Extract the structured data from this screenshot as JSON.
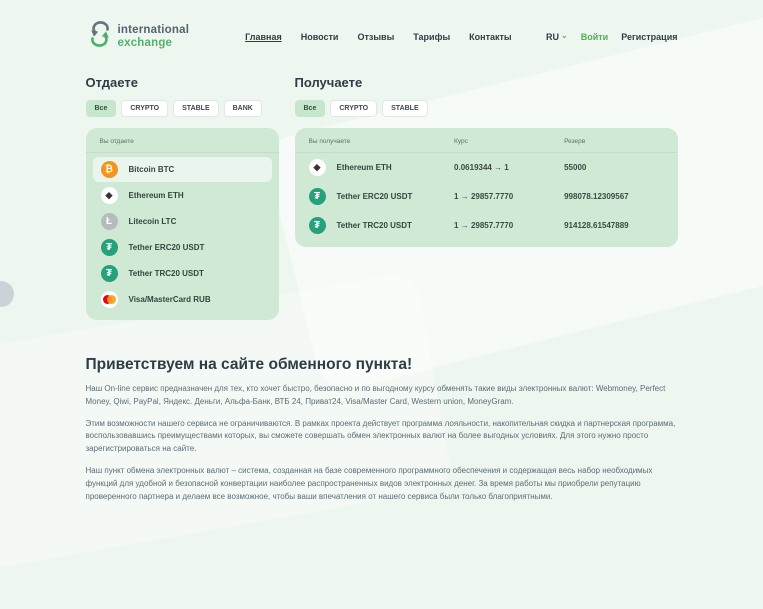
{
  "header": {
    "logo": {
      "line1": "international",
      "line2": "exchange"
    },
    "nav": [
      {
        "label": "Главная",
        "active": true
      },
      {
        "label": "Новости",
        "active": false
      },
      {
        "label": "Отзывы",
        "active": false
      },
      {
        "label": "Тарифы",
        "active": false
      },
      {
        "label": "Контакты",
        "active": false
      }
    ],
    "lang": "RU",
    "login_label": "Войти",
    "register_label": "Регистрация"
  },
  "give": {
    "title": "Отдаете",
    "tabs": [
      {
        "label": "Все",
        "active": true
      },
      {
        "label": "CRYPTO",
        "active": false
      },
      {
        "label": "STABLE",
        "active": false
      },
      {
        "label": "BANK",
        "active": false
      }
    ],
    "panel_label": "Вы отдаете",
    "items": [
      {
        "name": "Bitcoin BTC",
        "icon": "bitcoin-icon",
        "selected": true
      },
      {
        "name": "Ethereum ETH",
        "icon": "ethereum-icon",
        "selected": false
      },
      {
        "name": "Litecoin LTC",
        "icon": "litecoin-icon",
        "selected": false
      },
      {
        "name": "Tether ERC20 USDT",
        "icon": "tether-icon",
        "selected": false
      },
      {
        "name": "Tether TRC20 USDT",
        "icon": "tether-icon",
        "selected": false
      },
      {
        "name": "Visa/MasterCard RUB",
        "icon": "mastercard-icon",
        "selected": false
      }
    ]
  },
  "receive": {
    "title": "Получаете",
    "tabs": [
      {
        "label": "Все",
        "active": true
      },
      {
        "label": "CRYPTO",
        "active": false
      },
      {
        "label": "STABLE",
        "active": false
      }
    ],
    "columns": {
      "name": "Вы получаете",
      "rate": "Курс",
      "reserve": "Резерв"
    },
    "rows": [
      {
        "name": "Ethereum ETH",
        "icon": "ethereum-icon",
        "rate": "0.0619344 → 1",
        "reserve": "55000"
      },
      {
        "name": "Tether ERC20 USDT",
        "icon": "tether-icon",
        "rate": "1 → 29857.7770",
        "reserve": "998078.12309567"
      },
      {
        "name": "Tether TRC20 USDT",
        "icon": "tether-icon",
        "rate": "1 → 29857.7770",
        "reserve": "914128.61547889"
      }
    ]
  },
  "welcome": {
    "title": "Приветствуем на сайте обменного пункта!",
    "paragraphs": [
      "Наш On-line сервис предназначен для тех, кто хочет быстро, безопасно и по выгодному курсу обменять такие виды электронных валют: Webmoney, Perfect Money, Qiwi, PayPal, Яндекс. Деньги, Альфа-Банк, ВТБ 24, Приват24, Visa/Master Card, Western union, MoneyGram.",
      "Этим возможности нашего сервиса не ограничиваются. В рамках проекта действует программа лояльности, накопительная скидка и партнерская программа, воспользовавшись преимуществами которых, вы сможете совершать обмен электронных валют на более выгодных условиях. Для этого нужно просто зарегистрироваться на сайте.",
      "Наш пункт обмена электронных валют – система, созданная на базе современного программного обеспечения и содержащая весь набор необходимых функций для удобной и безопасной конвертации наиболее распространенных видов электронных денег. За время работы мы приобрели репутацию проверенного партнера и делаем все возможное, чтобы ваши впечатления от нашего сервиса были только благоприятными."
    ]
  },
  "icons": {
    "bitcoin_glyph": "₿",
    "ethereum_glyph": "◆",
    "litecoin_glyph": "Ł",
    "tether_glyph": "₮",
    "lang_chevron": "⌄"
  },
  "colors": {
    "accent_green": "#4caf50",
    "panel_green": "#cfe9d5",
    "tab_active": "#c6e7cd",
    "bitcoin_orange": "#f7931a",
    "tether_green": "#26a17b",
    "litecoin_gray": "#b6bbbd",
    "mastercard_red": "#eb001b",
    "mastercard_orange": "#f79e1b",
    "heading_dark": "#2e3d45",
    "body_text": "#5c6d76"
  }
}
